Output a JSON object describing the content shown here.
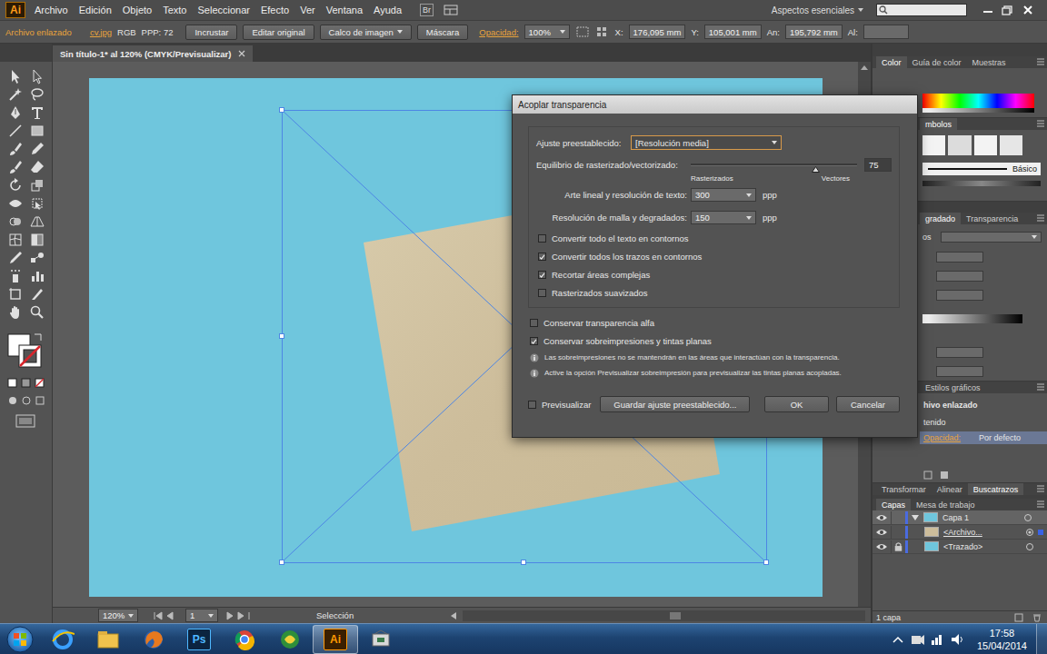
{
  "menubar": {
    "logo": "Ai",
    "menus": [
      "Archivo",
      "Edición",
      "Objeto",
      "Texto",
      "Seleccionar",
      "Efecto",
      "Ver",
      "Ventana",
      "Ayuda"
    ],
    "bridge": "Br",
    "workspace": "Aspectos esenciales"
  },
  "control_bar": {
    "label": "Archivo enlazado",
    "file": "cv.jpg",
    "mode": "RGB",
    "ppi": "PPP: 72",
    "buttons": [
      "Incrustar",
      "Editar original",
      "Calco de imagen",
      "Máscara"
    ],
    "opacity_label": "Opacidad:",
    "opacity": "100%",
    "coords": [
      {
        "label": "X:",
        "value": "176,095 mm"
      },
      {
        "label": "Y:",
        "value": "105,001 mm"
      },
      {
        "label": "An:",
        "value": "195,792 mm"
      }
    ],
    "height_label": "Al:"
  },
  "document_tab": {
    "title": "Sin título-1* al 120% (CMYK/Previsualizar)"
  },
  "dialog": {
    "title": "Acoplar transparencia",
    "preset": {
      "label": "Ajuste preestablecido:",
      "value": "[Resolución media]"
    },
    "balance": {
      "label": "Equilibrio de rasterizado/vectorizado:",
      "level": 0.75,
      "value": "75",
      "min_label": "Rasterizados",
      "max_label": "Vectores"
    },
    "resolutions": [
      {
        "label": "Arte lineal y resolución de texto:",
        "value": "300",
        "unit": "ppp"
      },
      {
        "label": "Resolución de malla y degradados:",
        "value": "150",
        "unit": "ppp"
      }
    ],
    "options": [
      {
        "label": "Convertir todo el texto en contornos",
        "checked": false
      },
      {
        "label": "Convertir todos los trazos en contornos",
        "checked": true
      },
      {
        "label": "Recortar áreas complejas",
        "checked": true
      },
      {
        "label": "Rasterizados suavizados",
        "checked": false
      }
    ],
    "preserve": [
      {
        "label": "Conservar transparencia alfa",
        "checked": false
      },
      {
        "label": "Conservar sobreimpresiones y tintas planas",
        "checked": true
      }
    ],
    "notes": [
      "Las sobreimpresiones no se mantendrán en las áreas que interactúan con la transparencia.",
      "Active la opción Previsualizar sobreimpresión para previsualizar las tintas planas acopladas."
    ],
    "preview": {
      "label": "Previsualizar",
      "checked": false
    },
    "save_button": "Guardar ajuste preestablecido...",
    "ok_button": "OK",
    "cancel_button": "Cancelar"
  },
  "panels": {
    "color": {
      "tabs": [
        {
          "label": "Color",
          "selected": true
        },
        {
          "label": "Guía de color",
          "selected": false
        },
        {
          "label": "Muestras",
          "selected": false
        }
      ]
    },
    "symbols": {
      "tabs": [
        {
          "label": "mbolos",
          "selected": true
        }
      ],
      "brush": "Básico"
    },
    "gradient": {
      "tabs": [
        {
          "label": "gradado",
          "selected": true
        },
        {
          "label": "Transparencia",
          "selected": false
        }
      ],
      "type_label": "os"
    },
    "styles": {
      "tabs": [
        {
          "label": "Estilos gráficos",
          "selected": false
        }
      ]
    },
    "appearance": {
      "title": "hivo enlazado",
      "content": "tenido",
      "opacity": {
        "label": "Opacidad:",
        "value": "Por defecto",
        "selected": true
      }
    },
    "transform": {
      "tabs": [
        {
          "label": "Transformar",
          "selected": false
        },
        {
          "label": "Alinear",
          "selected": false
        },
        {
          "label": "Buscatrazos",
          "selected": true
        }
      ]
    },
    "layers": {
      "tabs": [
        {
          "label": "Capas",
          "selected": true
        },
        {
          "label": "Mesa de trabajo",
          "selected": false
        }
      ],
      "layer": {
        "name": "Capa 1",
        "visible": true,
        "expanded": true,
        "selected": true
      },
      "items": [
        {
          "name": "<Archivo...",
          "visible": true,
          "locked": false,
          "selected": true
        },
        {
          "name": "<Trazado>",
          "visible": true,
          "locked": true,
          "selected": false
        }
      ],
      "footer": "1 capa"
    }
  },
  "status_bar": {
    "zoom": "120%",
    "page": "1",
    "tool": "Selección"
  },
  "taskbar": {
    "apps": [
      {
        "kind": "ie",
        "active": false
      },
      {
        "kind": "explorer",
        "active": false
      },
      {
        "kind": "firefox",
        "active": false
      },
      {
        "kind": "photoshop",
        "label": "Ps",
        "active": false
      },
      {
        "kind": "chrome",
        "active": false
      },
      {
        "kind": "green",
        "active": false
      },
      {
        "kind": "illustrator",
        "label": "Ai",
        "active": true
      },
      {
        "kind": "tool",
        "active": false
      }
    ],
    "time": "17:58",
    "date": "15/04/2014"
  }
}
